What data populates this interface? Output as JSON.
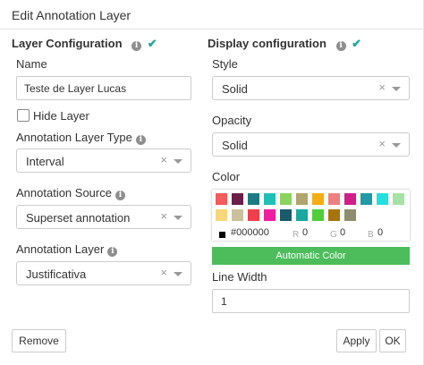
{
  "dialog": {
    "title": "Edit Annotation Layer"
  },
  "layer_config": {
    "title": "Layer Configuration",
    "info_glyph": "i",
    "check_glyph": "✔",
    "name_label": "Name",
    "name_value": "Teste de Layer Lucas",
    "hide_layer_label": "Hide Layer",
    "hide_layer_checked": false,
    "type_label": "Annotation Layer Type",
    "type_value": "Interval",
    "source_label": "Annotation Source",
    "source_value": "Superset annotation",
    "layer_label": "Annotation Layer",
    "layer_value": "Justificativa"
  },
  "display_config": {
    "title": "Display configuration",
    "style_label": "Style",
    "style_value": "Solid",
    "opacity_label": "Opacity",
    "opacity_value": "Solid",
    "color_label": "Color",
    "swatches_row1": [
      "#f45b5b",
      "#6b1e4a",
      "#1c7a84",
      "#1fc0b8",
      "#8bd35f",
      "#b0a56e",
      "#f5ad12",
      "#f08080",
      "#d21e8a",
      "#1e9aa8",
      "#22e0e0",
      "#a5e3a5"
    ],
    "swatches_row2": [
      "#f7d77a",
      "#cbc09c",
      "#f03e4a",
      "#f01ea0",
      "#1a5a6a",
      "#1aa8a0",
      "#4fcf3a",
      "#a8740a",
      "#8e8e6e"
    ],
    "hex_value": "#000000",
    "r_label": "R",
    "r_value": "0",
    "g_label": "G",
    "g_value": "0",
    "b_label": "B",
    "b_value": "0",
    "automatic_color_label": "Automatic Color",
    "line_width_label": "Line Width",
    "line_width_value": "1"
  },
  "footer": {
    "remove_label": "Remove",
    "apply_label": "Apply",
    "ok_label": "OK"
  },
  "icons": {
    "clear": "×"
  },
  "colors": {
    "accent_green": "#4dbd5c",
    "check_teal": "#1fa8a0"
  }
}
